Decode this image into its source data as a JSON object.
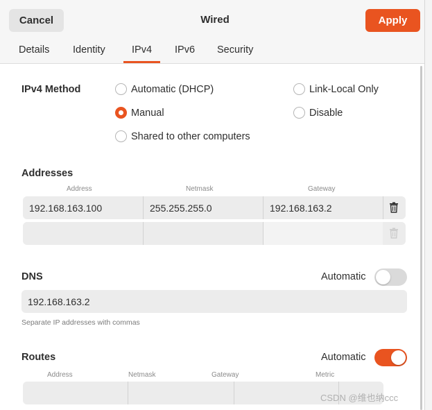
{
  "header": {
    "cancel_label": "Cancel",
    "title": "Wired",
    "apply_label": "Apply"
  },
  "tabs": [
    {
      "label": "Details",
      "active": false
    },
    {
      "label": "Identity",
      "active": false
    },
    {
      "label": "IPv4",
      "active": true
    },
    {
      "label": "IPv6",
      "active": false
    },
    {
      "label": "Security",
      "active": false
    }
  ],
  "ipv4_method": {
    "label": "IPv4 Method",
    "options": [
      {
        "label": "Automatic (DHCP)",
        "checked": false
      },
      {
        "label": "Link-Local Only",
        "checked": false
      },
      {
        "label": "Manual",
        "checked": true
      },
      {
        "label": "Disable",
        "checked": false
      },
      {
        "label": "Shared to other computers",
        "checked": false
      }
    ]
  },
  "addresses": {
    "label": "Addresses",
    "columns": [
      "Address",
      "Netmask",
      "Gateway"
    ],
    "rows": [
      {
        "address": "192.168.163.100",
        "netmask": "255.255.255.0",
        "gateway": "192.168.163.2"
      },
      {
        "address": "",
        "netmask": "",
        "gateway": ""
      }
    ]
  },
  "dns": {
    "label": "DNS",
    "automatic_label": "Automatic",
    "automatic": false,
    "value": "192.168.163.2",
    "hint": "Separate IP addresses with commas"
  },
  "routes": {
    "label": "Routes",
    "automatic_label": "Automatic",
    "automatic": true,
    "columns": [
      "Address",
      "Netmask",
      "Gateway",
      "Metric"
    ]
  },
  "watermark": "CSDN @维也纳ccc",
  "colors": {
    "accent": "#e95420",
    "background": "#ffffff",
    "field": "#ececec"
  }
}
